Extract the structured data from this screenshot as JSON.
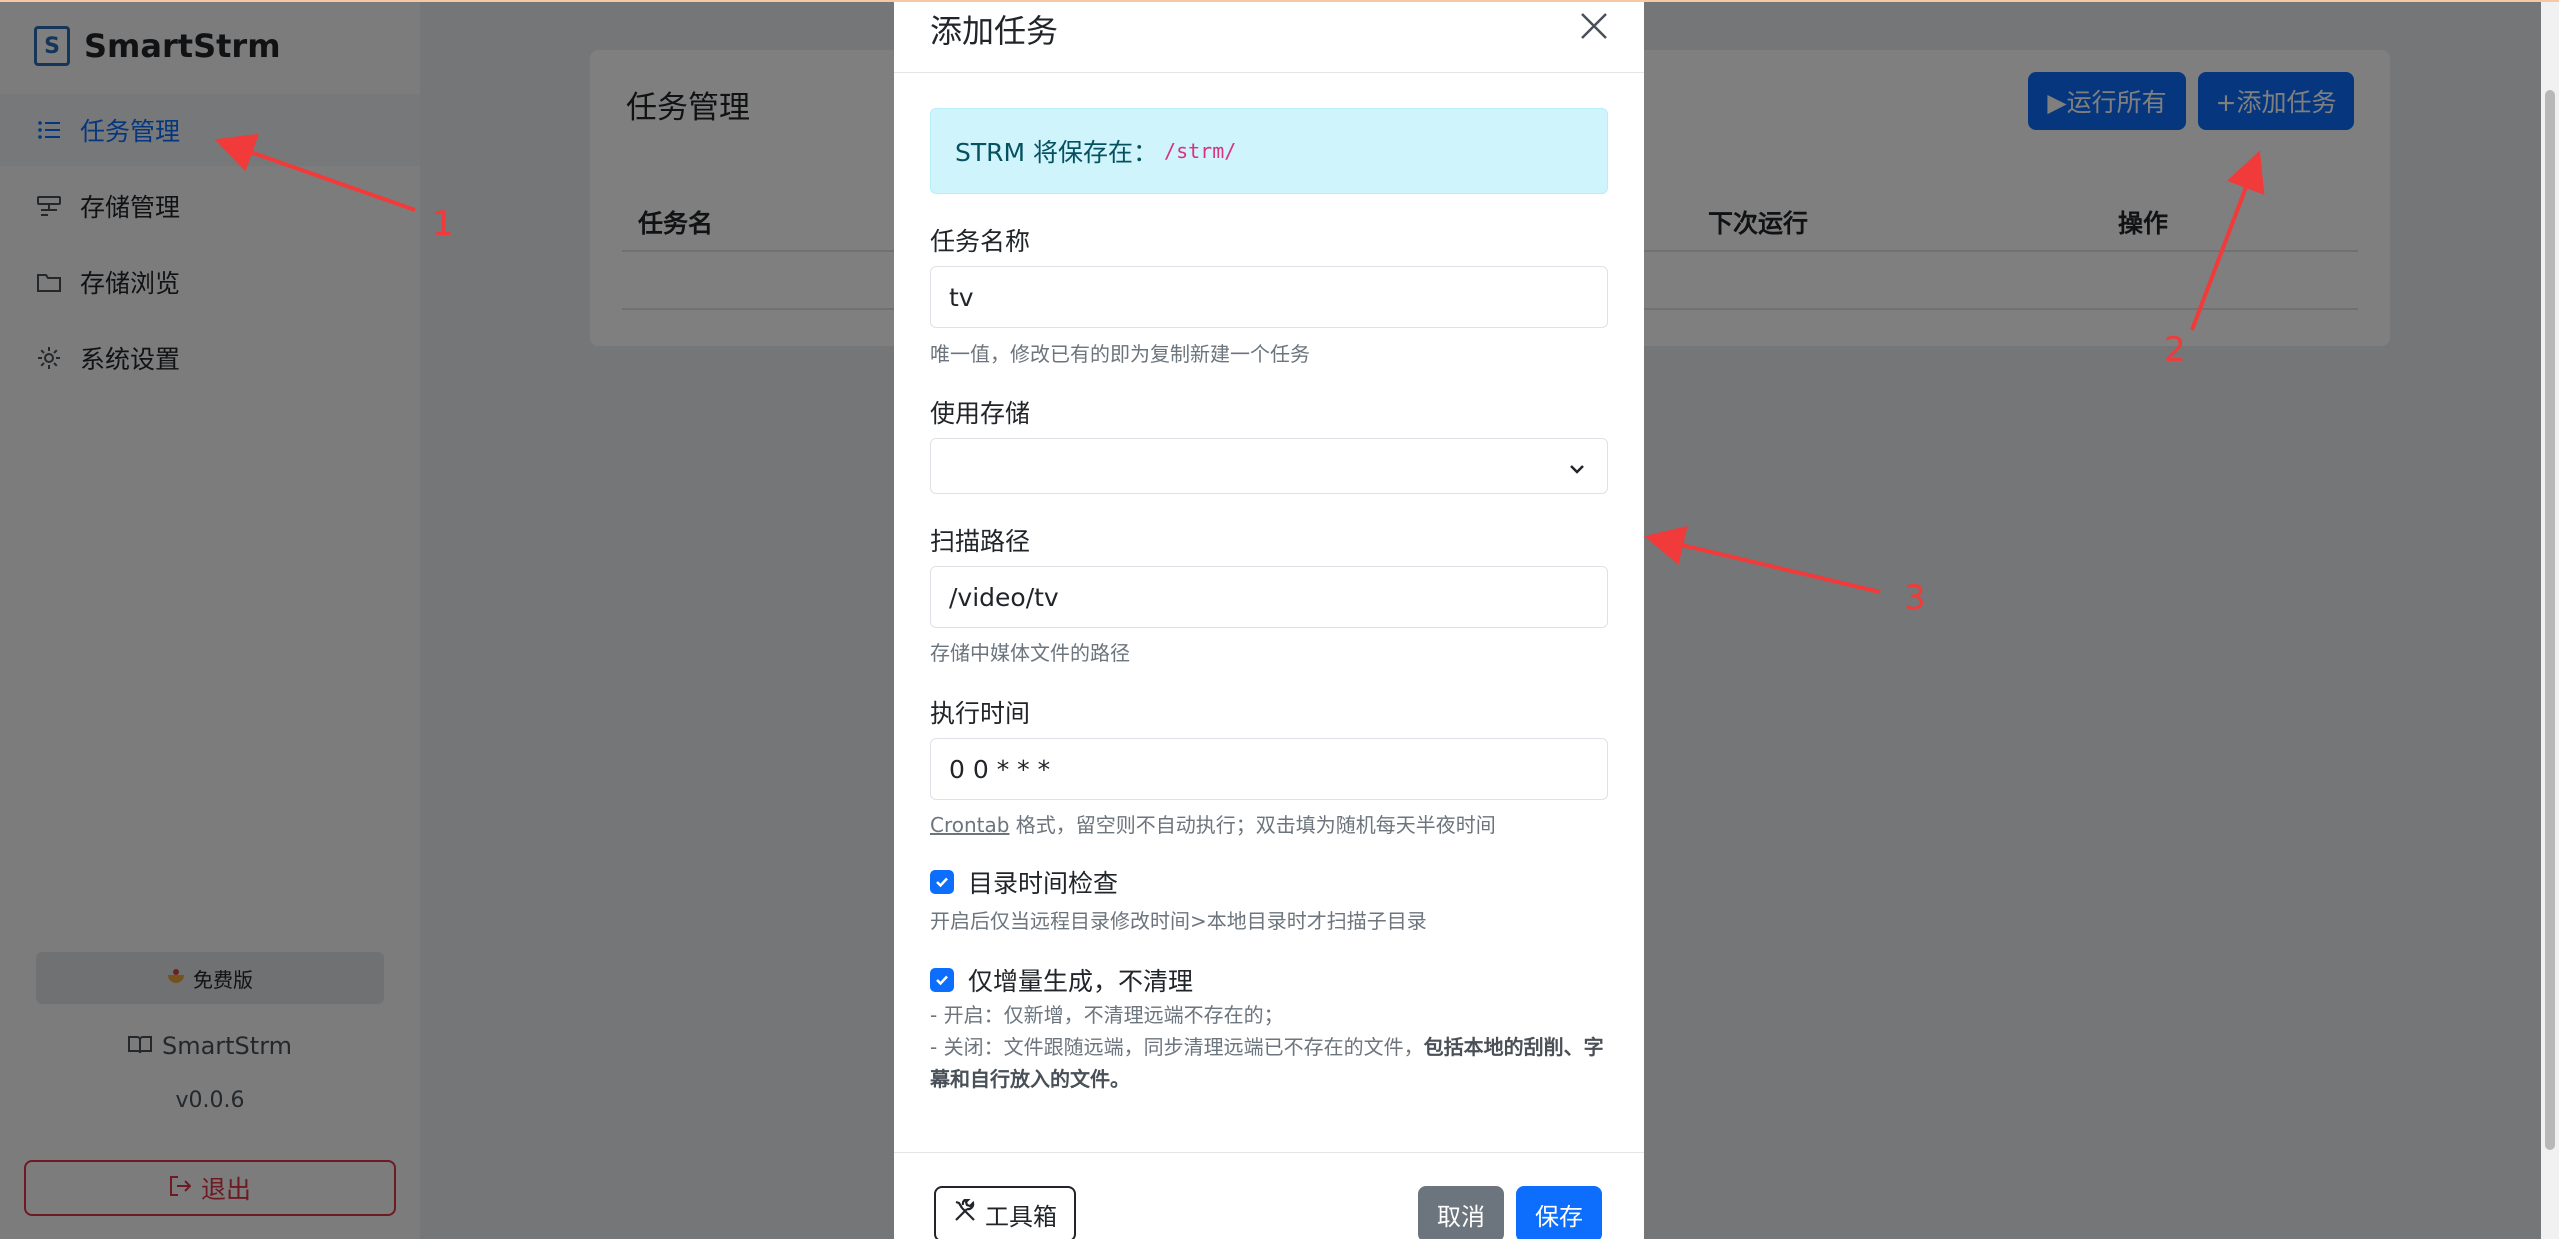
{
  "sidebar": {
    "brand": "SmartStrm",
    "items": [
      {
        "label": "任务管理",
        "icon": "list-icon",
        "active": true
      },
      {
        "label": "存储管理",
        "icon": "storage-icon"
      },
      {
        "label": "存储浏览",
        "icon": "folder-icon"
      },
      {
        "label": "系统设置",
        "icon": "gear-icon"
      }
    ],
    "badge": "免费版",
    "doc_link": "SmartStrm",
    "version": "v0.0.6",
    "logout": "退出"
  },
  "main": {
    "title": "任务管理",
    "run_all": "▶运行所有",
    "add_task": "+添加任务",
    "columns": [
      "任务名",
      "下次运行",
      "操作"
    ]
  },
  "modal": {
    "title": "添加任务",
    "info_text": "STRM 将保存在：",
    "info_path": "/strm/",
    "name_label": "任务名称",
    "name_value": "tv",
    "name_help": "唯一值，修改已有的即为复制新建一个任务",
    "storage_label": "使用存储",
    "storage_value": "",
    "scan_label": "扫描路径",
    "scan_value": "/video/tv",
    "scan_help": "存储中媒体文件的路径",
    "cron_label": "执行时间",
    "cron_value": "0 0 * * *",
    "cron_help_link": "Crontab",
    "cron_help": " 格式，留空则不自动执行；双击填为随机每天半夜时间",
    "dircheck_label": "目录时间检查",
    "dircheck_help": "开启后仅当远程目录修改时间>本地目录时才扫描子目录",
    "incremental_label": "仅增量生成，不清理",
    "incremental_help_1": "- 开启：仅新增，不清理远端不存在的；",
    "incremental_help_2": "- 关闭：文件跟随远端，同步清理远端已不存在的文件，",
    "incremental_help_bold": "包括本地的刮削、字幕和自行放入的文件。",
    "toolbox": "工具箱",
    "cancel": "取消",
    "save": "保存"
  },
  "annotations": [
    "1",
    "2",
    "3"
  ],
  "colors": {
    "primary": "#0d6efd",
    "danger": "#dc3545",
    "annotation": "#f13a3a",
    "info_bg": "#cff4fc"
  }
}
